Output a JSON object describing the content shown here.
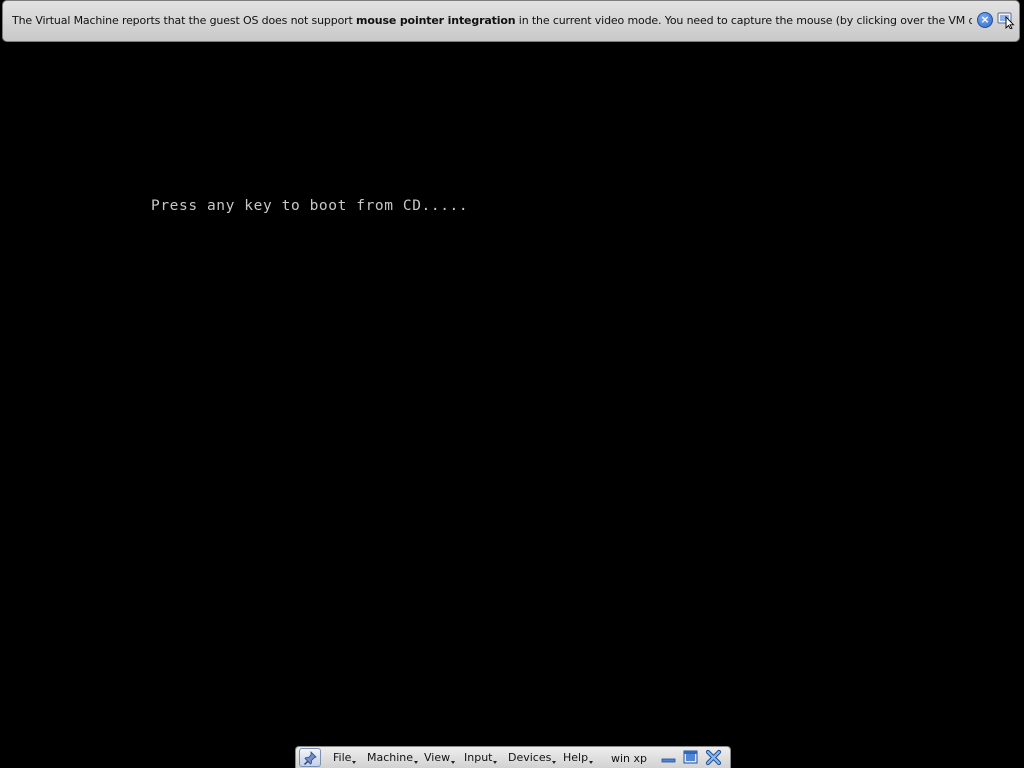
{
  "notification": {
    "text_before": "The Virtual Machine reports that the guest OS does not support ",
    "text_bold": "mouse pointer integration",
    "text_after": " in the current video mode. You need to capture the mouse (by clicking over the VM display or pressing",
    "close_icon": "close-icon",
    "mouse_icon": "mouse-pointer-icon"
  },
  "guest_display": {
    "boot_message": "Press any key to boot from CD....."
  },
  "mini_toolbar": {
    "pin_icon": "pin-icon",
    "menus": [
      "File",
      "Machine",
      "View",
      "Input",
      "Devices",
      "Help"
    ],
    "vm_name": "win xp",
    "buttons": {
      "minimize_icon": "minimize-icon",
      "restore_icon": "exit-fullscreen-icon",
      "close_icon": "close-vm-icon"
    }
  },
  "colors": {
    "screen_background": "#000000",
    "console_text": "#c8c8c8",
    "toolbar_accent": "#2a62c8"
  }
}
